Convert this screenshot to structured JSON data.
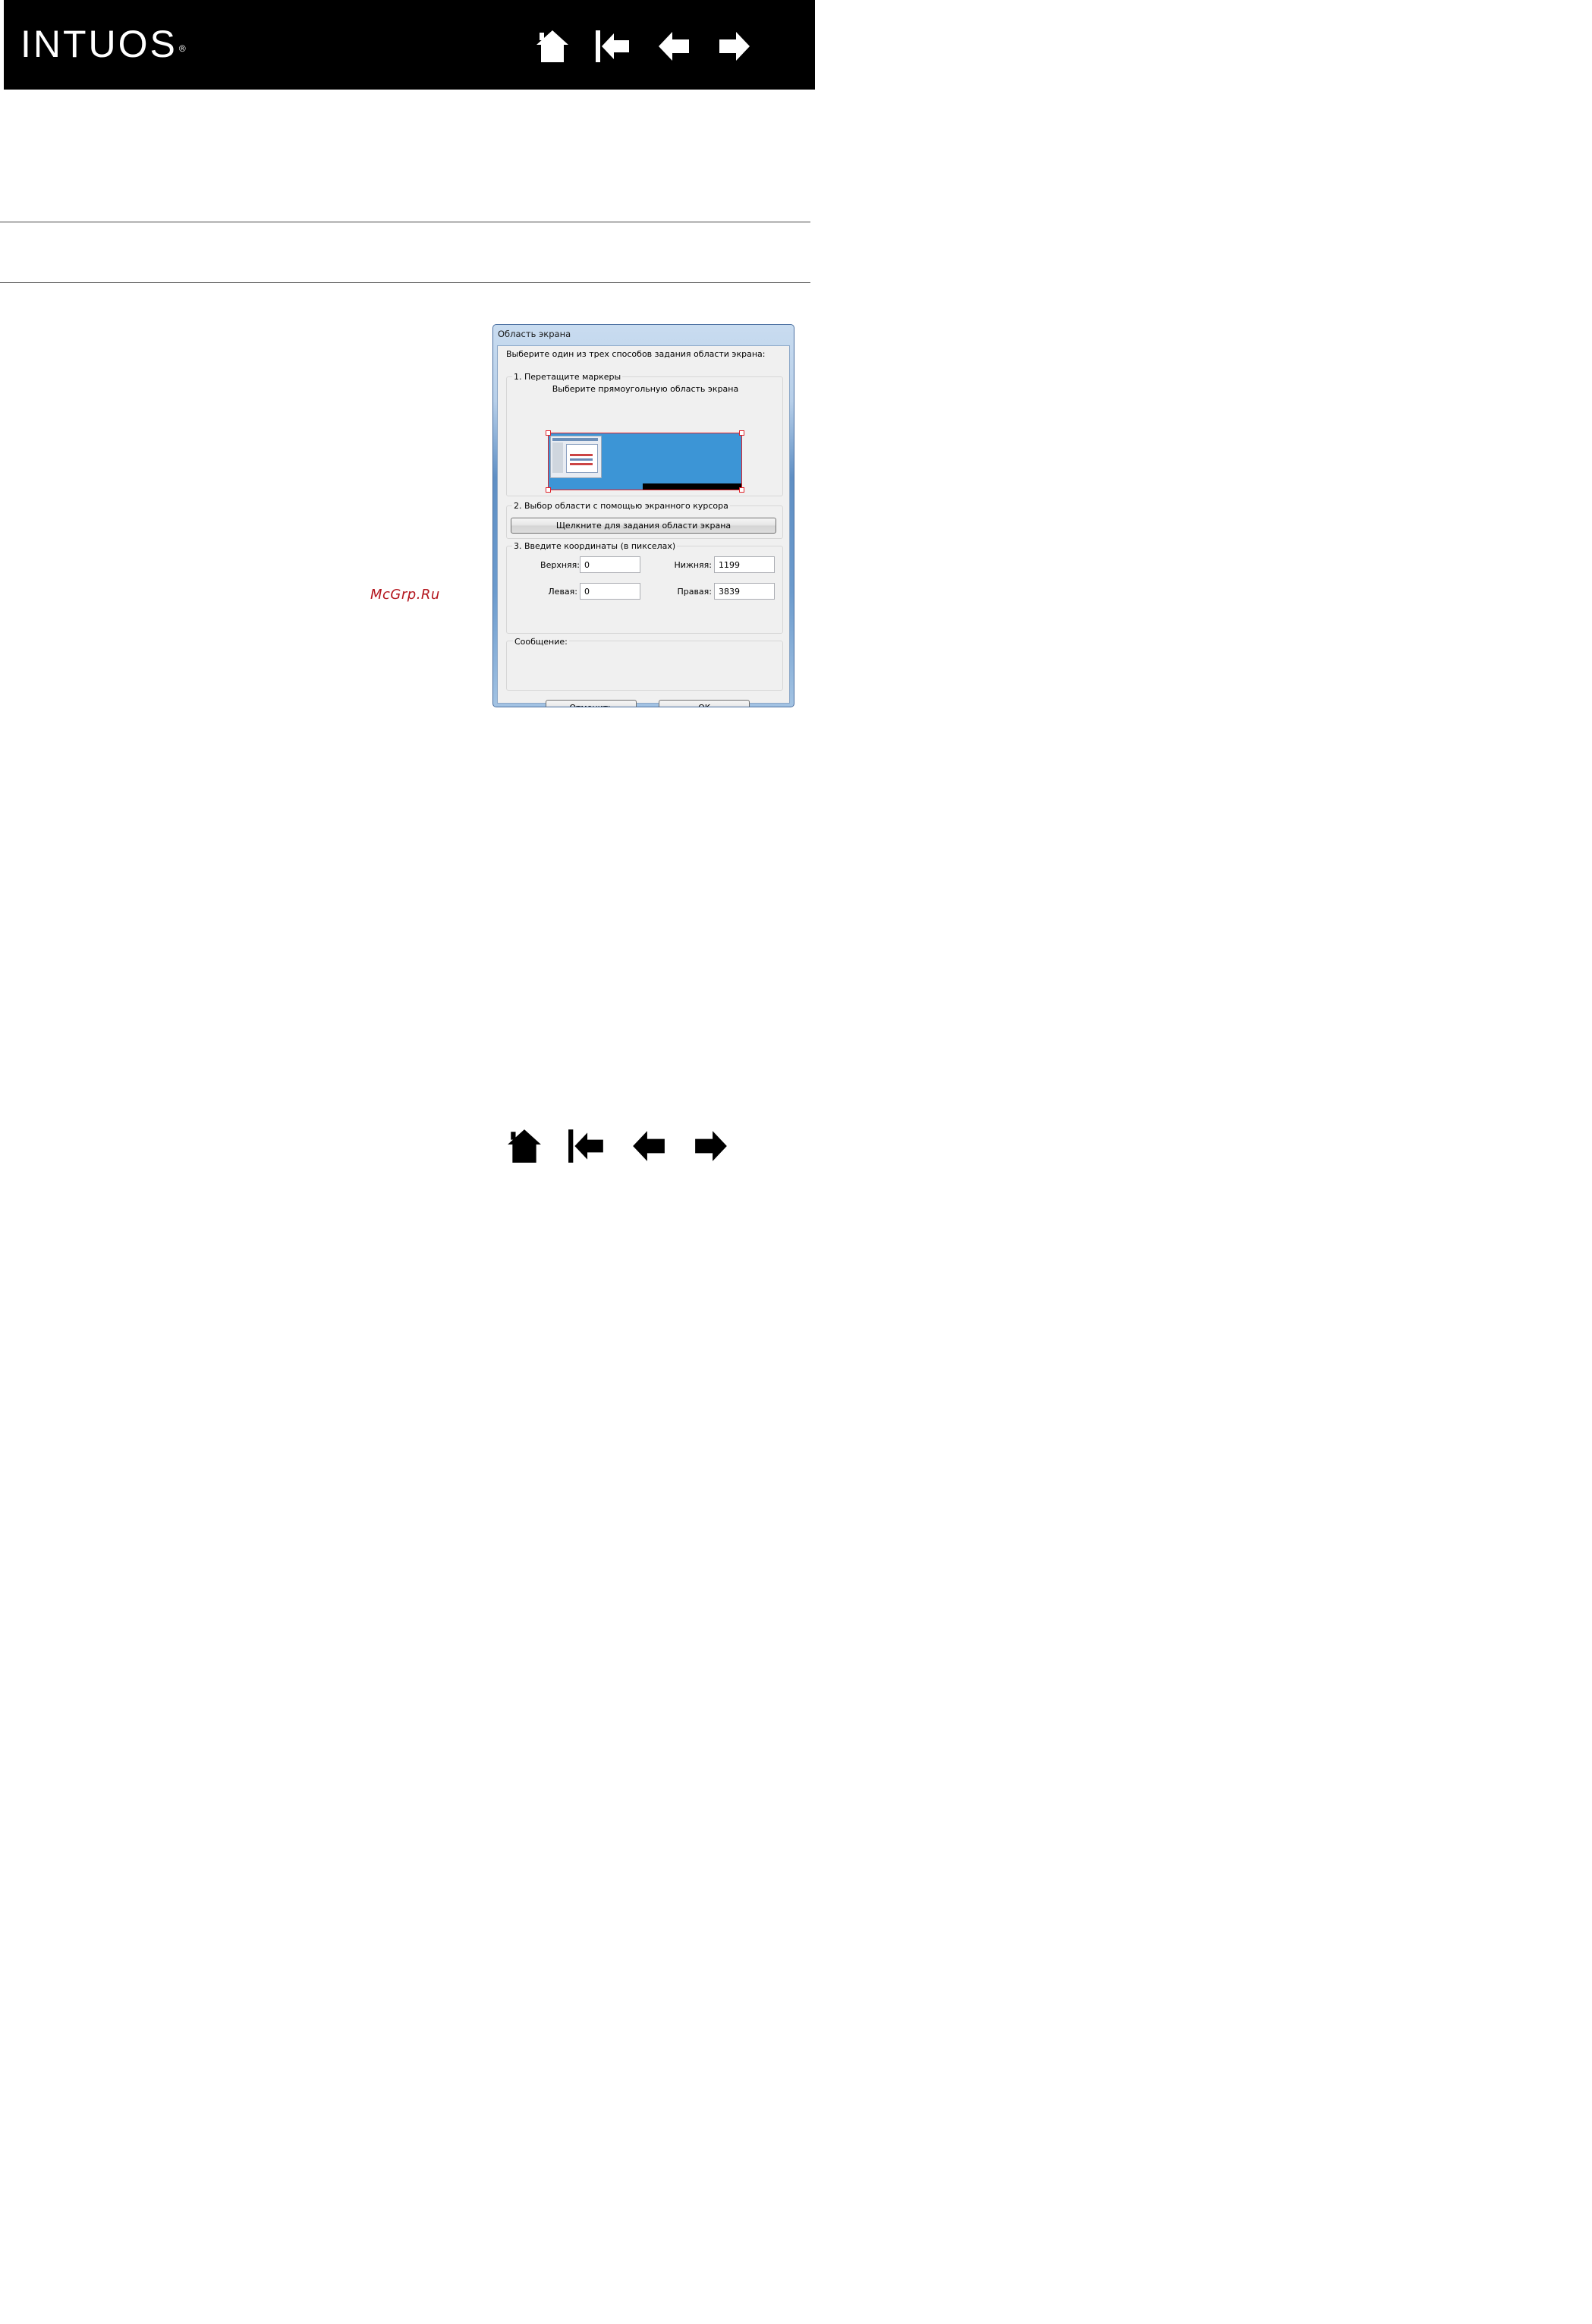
{
  "header": {
    "brand": "INTUOS",
    "registered": "®"
  },
  "nav": {
    "home_icon": "home-icon",
    "first_icon": "first-page-icon",
    "prev_icon": "previous-page-icon",
    "next_icon": "next-page-icon"
  },
  "watermark": "McGrp.Ru",
  "dialog": {
    "title": "Область экрана",
    "instruction": "Выберите один из трех способов задания области экрана:",
    "group1": {
      "title": "1. Перетащите маркеры",
      "subtitle": "Выберите прямоугольную область экрана"
    },
    "group2": {
      "title": "2. Выбор области с помощью экранного курсора",
      "button": "Щелкните для задания области экрана"
    },
    "group3": {
      "title": "3. Введите координаты (в пикселах)",
      "top_label": "Верхняя:",
      "top_value": "0",
      "bottom_label": "Нижняя:",
      "bottom_value": "1199",
      "left_label": "Левая:",
      "left_value": "0",
      "right_label": "Правая:",
      "right_value": "3839"
    },
    "message_label": "Сообщение:",
    "cancel_button": "Отменить",
    "ok_button": "OK"
  },
  "colors": {
    "accent": "#3c95d6",
    "marker": "#e0222a",
    "header_bg": "#000000"
  }
}
